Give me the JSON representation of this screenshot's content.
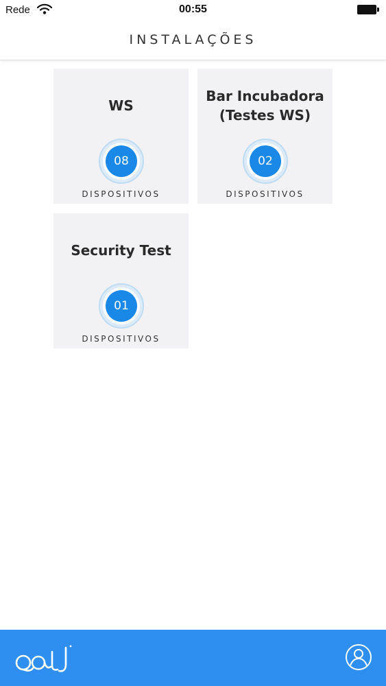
{
  "status_bar": {
    "carrier": "Rede",
    "time": "00:55"
  },
  "header": {
    "title": "INSTALAÇÕES"
  },
  "installations": [
    {
      "name": "WS",
      "count": "08",
      "caption": "DISPOSITIVOS"
    },
    {
      "name": "Bar Incubadora (Testes WS)",
      "name_line1": "Bar Incubadora",
      "name_line2": "(Testes WS)",
      "count": "02",
      "caption": "DISPOSITIVOS"
    },
    {
      "name": "Security Test",
      "count": "01",
      "caption": "DISPOSITIVOS"
    }
  ],
  "icons": {
    "logo": "app-logo",
    "profile": "user-profile-icon"
  },
  "colors": {
    "accent": "#2f8ff0",
    "badge": "#1a88e6",
    "card_bg": "#f2f2f4"
  }
}
